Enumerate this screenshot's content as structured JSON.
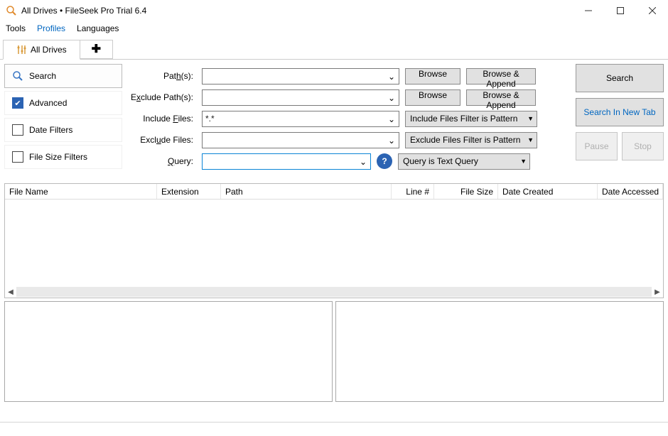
{
  "window": {
    "title": "All Drives • FileSeek Pro Trial 6.4"
  },
  "menu": {
    "tools": "Tools",
    "profiles": "Profiles",
    "languages": "Languages"
  },
  "tabs": {
    "active": "All Drives"
  },
  "sidebar": {
    "search": "Search",
    "advanced": "Advanced",
    "date_filters": "Date Filters",
    "file_size_filters": "File Size Filters"
  },
  "form": {
    "paths_label": "Path(s):",
    "paths_value": "",
    "exclude_paths_label": "Exclude Path(s):",
    "exclude_paths_value": "",
    "include_files_label": "Include Files:",
    "include_files_value": "*.*",
    "exclude_files_label": "Exclude Files:",
    "exclude_files_value": "",
    "query_label": "Query:",
    "query_value": "",
    "browse": "Browse",
    "browse_append": "Browse & Append",
    "include_type": "Include Files Filter is Pattern",
    "exclude_type": "Exclude Files Filter is Pattern",
    "query_type": "Query is Text Query"
  },
  "buttons": {
    "search": "Search",
    "search_new_tab": "Search In New Tab",
    "pause": "Pause",
    "stop": "Stop"
  },
  "columns": {
    "file_name": "File Name",
    "extension": "Extension",
    "path": "Path",
    "line_no": "Line #",
    "file_size": "File Size",
    "date_created": "Date Created",
    "date_accessed": "Date Accessed"
  }
}
